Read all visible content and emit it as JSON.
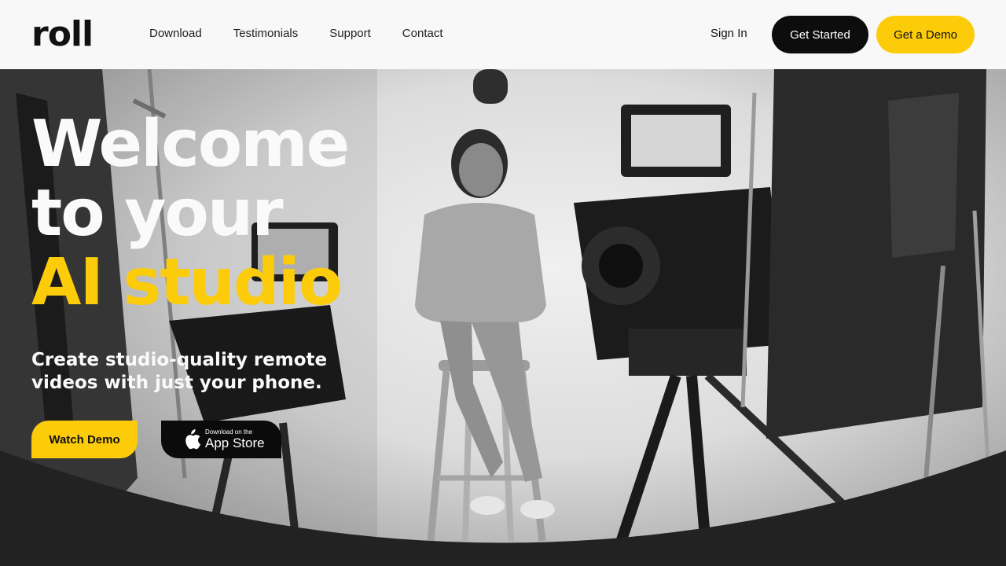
{
  "brand": {
    "logo_text": "roll"
  },
  "nav": {
    "items": [
      {
        "label": "Download"
      },
      {
        "label": "Testimonials"
      },
      {
        "label": "Support"
      },
      {
        "label": "Contact"
      }
    ]
  },
  "header_actions": {
    "sign_in": "Sign In",
    "get_started": "Get Started",
    "get_demo": "Get a Demo"
  },
  "hero": {
    "title_line1": "Welcome",
    "title_line2": "to your",
    "title_line3": "AI studio",
    "subtitle": "Create studio-quality remote videos with just your phone.",
    "watch_demo": "Watch Demo",
    "appstore_small": "Download on the",
    "appstore_big": "App Store",
    "appstore_icon": "apple-icon"
  },
  "colors": {
    "accent": "#fccc0a",
    "dark": "#0d0d0d",
    "background": "#f8f8f8",
    "curve": "#222222"
  }
}
